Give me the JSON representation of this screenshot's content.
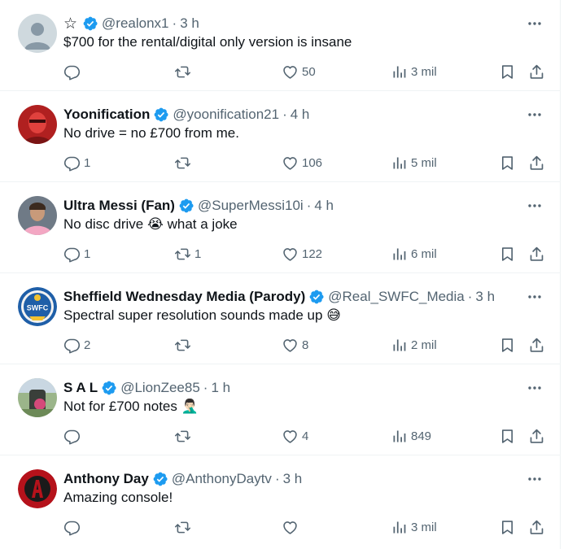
{
  "tweets": [
    {
      "name": "",
      "has_star": true,
      "verified": true,
      "handle": "@realonx1",
      "time": "3 h",
      "text": "$700 for the rental/digital only version is insane",
      "emoji": "",
      "avatar": "default-avatar",
      "replies": "",
      "retweets": "",
      "likes": "50",
      "views": "3 mil"
    },
    {
      "name": "Yoonification",
      "has_star": false,
      "verified": true,
      "handle": "@yoonification21",
      "time": "4 h",
      "text": "No drive = no £700 from me.",
      "emoji": "",
      "avatar": "red-portrait-avatar",
      "replies": "1",
      "retweets": "",
      "likes": "106",
      "views": "5 mil"
    },
    {
      "name": "Ultra Messi (Fan)",
      "has_star": false,
      "verified": true,
      "handle": "@SuperMessi10i",
      "time": "4 h",
      "text": "No disc drive",
      "emoji": "😭",
      "text_after": "what a joke",
      "avatar": "messi-photo-avatar",
      "replies": "1",
      "retweets": "1",
      "likes": "122",
      "views": "6 mil"
    },
    {
      "name": "Sheffield Wednesday Media (Parody)",
      "has_star": false,
      "verified": true,
      "handle": "@Real_SWFC_Media",
      "time": "3 h",
      "text": "Spectral super resolution sounds made up",
      "emoji": "😅",
      "avatar": "swfc-crest-avatar",
      "avatar_text": "SWFC",
      "replies": "2",
      "retweets": "",
      "likes": "8",
      "views": "2 mil"
    },
    {
      "name": "S A L",
      "has_star": false,
      "verified": true,
      "handle": "@LionZee85",
      "time": "1 h",
      "text": "Not for £700 notes",
      "emoji": "🤦🏻‍♂️",
      "avatar": "outdoor-photo-avatar",
      "replies": "",
      "retweets": "",
      "likes": "4",
      "views": "849"
    },
    {
      "name": "Anthony Day",
      "has_star": false,
      "verified": true,
      "handle": "@AnthonyDaytv",
      "time": "3 h",
      "text": "Amazing console!",
      "emoji": "",
      "avatar": "red-logo-avatar",
      "replies": "",
      "retweets": "",
      "likes": "",
      "views": "3 mil"
    }
  ],
  "separator": "·",
  "icons": {
    "reply": "reply-icon",
    "retweet": "retweet-icon",
    "like": "heart-icon",
    "views": "views-icon",
    "bookmark": "bookmark-icon",
    "share": "share-icon",
    "more": "more-icon",
    "verified": "verified-badge-icon"
  },
  "colors": {
    "verified": "#1d9bf0",
    "text": "#0f1419",
    "secondary": "#536471",
    "border": "#eff3f4"
  }
}
